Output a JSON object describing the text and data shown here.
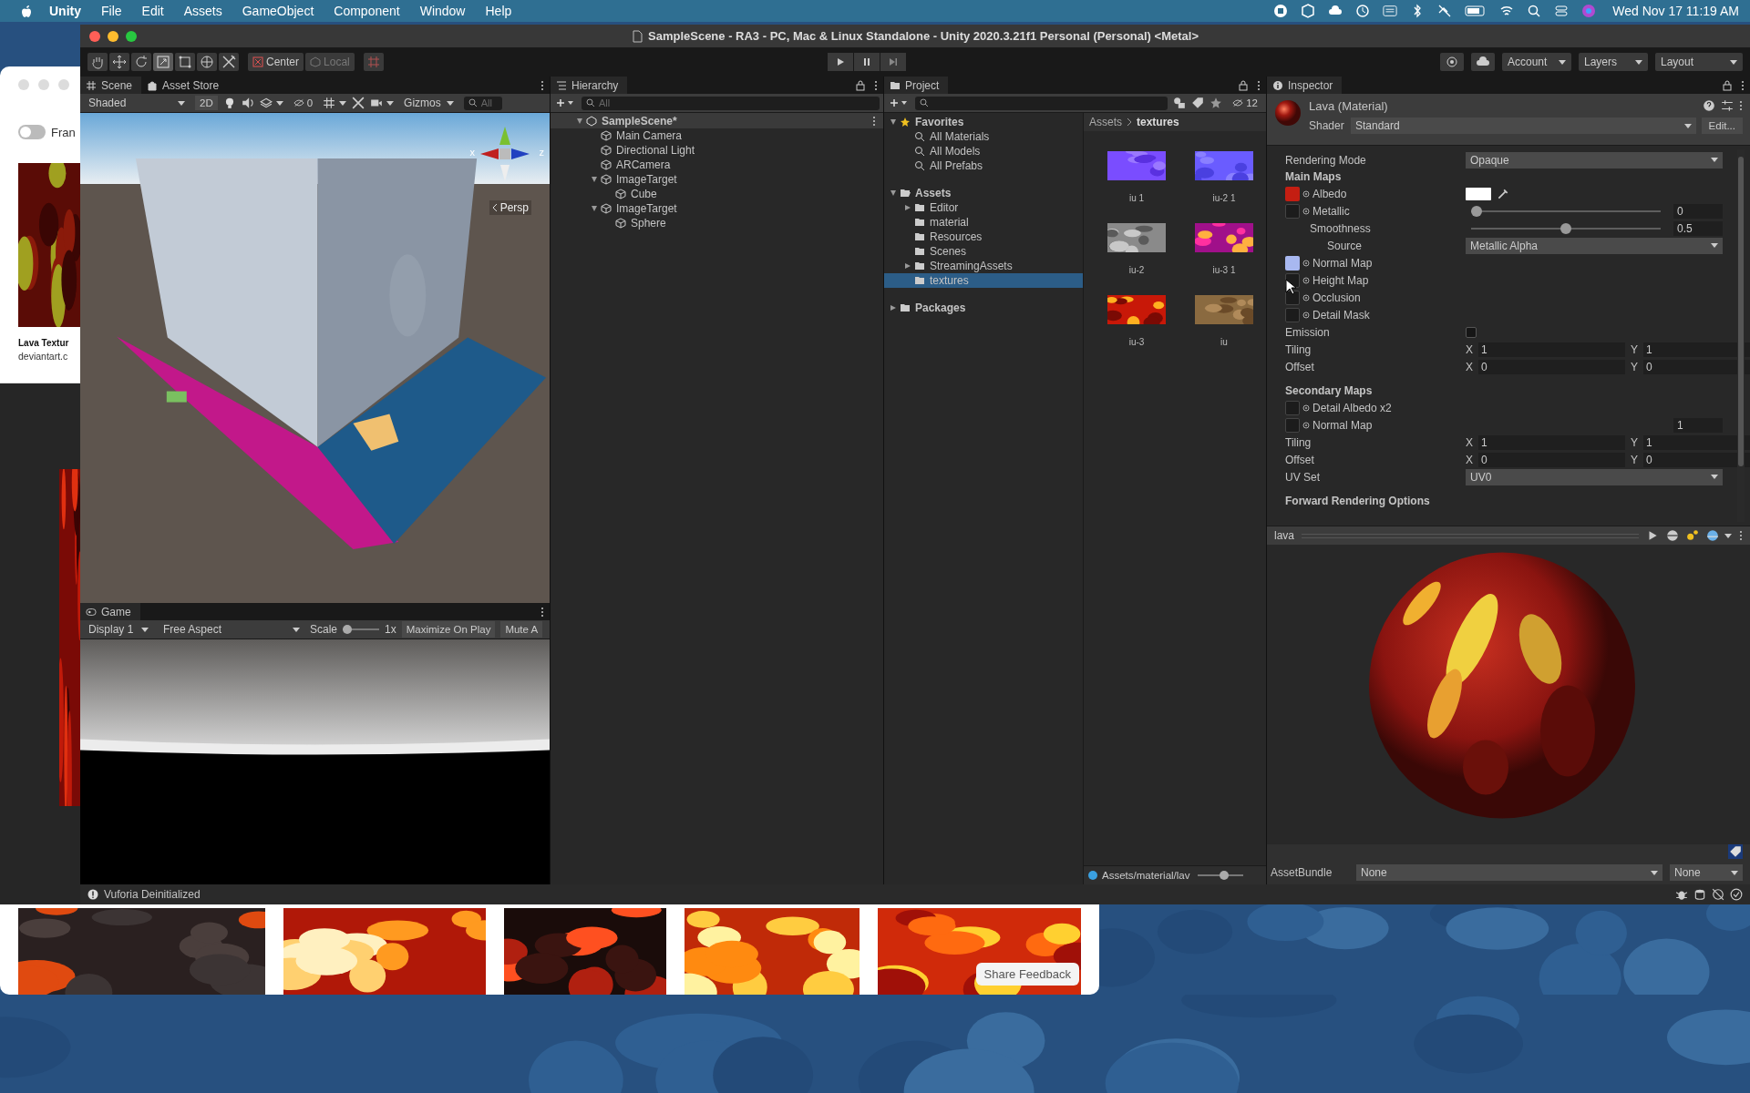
{
  "menu_bar": {
    "app": "Unity",
    "items": [
      "File",
      "Edit",
      "Assets",
      "GameObject",
      "Component",
      "Window",
      "Help"
    ],
    "clock": "Wed Nov 17  11:19 AM"
  },
  "browser": {
    "toggle": {
      "label": "Fran",
      "on": false
    },
    "result_title": "Lava Textur",
    "result_source": "deviantart.c",
    "share_button": "Share Feedback"
  },
  "window": {
    "title": "SampleScene - RA3 - PC, Mac & Linux Standalone - Unity 2020.3.21f1 Personal (Personal) <Metal>"
  },
  "toolbar": {
    "pivot": {
      "label": "Center",
      "disabled": false
    },
    "space": {
      "label": "Local",
      "disabled": true
    },
    "menus": [
      "Account",
      "Layers",
      "Layout"
    ]
  },
  "scene": {
    "tabs": [
      {
        "label": "Scene",
        "selected": true
      },
      {
        "label": "Asset Store",
        "selected": false
      }
    ],
    "shading": "Shaded",
    "mode_2d": "2D",
    "hidden_count": "0",
    "gizmos": "Gizmos",
    "search_placeholder": "All",
    "axes": [
      "x",
      "z"
    ],
    "projection": "Persp"
  },
  "game": {
    "tab": "Game",
    "display": "Display 1",
    "aspect": "Free Aspect",
    "scale_label": "Scale",
    "scale": {
      "level": 0,
      "reading": "1x"
    },
    "buttons": [
      "Maximize On Play",
      "Mute A"
    ]
  },
  "hierarchy": {
    "title": "Hierarchy",
    "search_placeholder": "All",
    "tree": [
      {
        "label": "SampleScene*",
        "kind": "scene",
        "expanded": true,
        "selected": false,
        "children": [
          {
            "label": "Main Camera",
            "kind": "object",
            "selected": false
          },
          {
            "label": "Directional Light",
            "kind": "object",
            "selected": false
          },
          {
            "label": "ARCamera",
            "kind": "object",
            "selected": false
          },
          {
            "label": "ImageTarget",
            "kind": "object",
            "expanded": true,
            "selected": false,
            "children": [
              {
                "label": "Cube",
                "kind": "object",
                "selected": false
              }
            ]
          },
          {
            "label": "ImageTarget",
            "kind": "object",
            "expanded": true,
            "selected": false,
            "children": [
              {
                "label": "Sphere",
                "kind": "object",
                "selected": false
              }
            ]
          }
        ]
      }
    ]
  },
  "project": {
    "title": "Project",
    "hidden_count": "12",
    "tree": [
      {
        "label": "Favorites",
        "kind": "favorites",
        "expanded": true,
        "selected": false,
        "children": [
          {
            "label": "All Materials",
            "kind": "search",
            "selected": false
          },
          {
            "label": "All Models",
            "kind": "search",
            "selected": false
          },
          {
            "label": "All Prefabs",
            "kind": "search",
            "selected": false
          }
        ]
      },
      {
        "label": "Assets",
        "kind": "folder",
        "expanded": true,
        "selected": false,
        "children": [
          {
            "label": "Editor",
            "kind": "folder",
            "expanded": false,
            "selected": false
          },
          {
            "label": "material",
            "kind": "folder",
            "selected": false
          },
          {
            "label": "Resources",
            "kind": "folder",
            "selected": false
          },
          {
            "label": "Scenes",
            "kind": "folder",
            "selected": false
          },
          {
            "label": "StreamingAssets",
            "kind": "folder",
            "expanded": false,
            "selected": false
          },
          {
            "label": "textures",
            "kind": "folder",
            "selected": true
          }
        ]
      },
      {
        "label": "Packages",
        "kind": "folder",
        "expanded": false,
        "selected": false
      }
    ],
    "breadcrumb": [
      "Assets",
      "textures"
    ],
    "assets": [
      {
        "label": "iu 1",
        "selected": false
      },
      {
        "label": "iu-2 1",
        "selected": false
      },
      {
        "label": "iu-2",
        "selected": false
      },
      {
        "label": "iu-3 1",
        "selected": false
      },
      {
        "label": "iu-3",
        "selected": false
      },
      {
        "label": "iu",
        "selected": false
      }
    ],
    "path": "Assets/material/lav",
    "zoom": {
      "level": 0.6
    }
  },
  "inspector": {
    "title": "Inspector",
    "asset": "Lava (Material)",
    "shader_label": "Shader",
    "shader": "Standard",
    "edit_button": "Edit...",
    "properties": [
      {
        "kind": "dropdown",
        "label": "Rendering Mode",
        "value": "Opaque"
      },
      {
        "kind": "header",
        "label": "Main Maps"
      },
      {
        "kind": "texture_color",
        "label": "Albedo",
        "color": "#c41e12"
      },
      {
        "kind": "texture",
        "label": "Metallic",
        "level": 0,
        "value": "0",
        "children": [
          {
            "kind": "slider",
            "label": "Smoothness",
            "level": 0.5,
            "value": "0.5",
            "children": [
              {
                "kind": "dropdown",
                "label": "Source",
                "value": "Metallic Alpha"
              }
            ]
          }
        ]
      },
      {
        "kind": "texture",
        "label": "Normal Map",
        "color": "#a8b8f0"
      },
      {
        "kind": "texture",
        "label": "Height Map"
      },
      {
        "kind": "texture",
        "label": "Occlusion"
      },
      {
        "kind": "texture",
        "label": "Detail Mask"
      },
      {
        "kind": "checkbox",
        "label": "Emission",
        "checked": false
      },
      {
        "kind": "vector",
        "label": "Tiling",
        "components": [
          {
            "axis": "X",
            "value": "1"
          },
          {
            "axis": "Y",
            "value": "1"
          }
        ]
      },
      {
        "kind": "vector",
        "label": "Offset",
        "components": [
          {
            "axis": "X",
            "value": "0"
          },
          {
            "axis": "Y",
            "value": "0"
          }
        ]
      },
      {
        "kind": "header",
        "label": "Secondary Maps"
      },
      {
        "kind": "texture",
        "label": "Detail Albedo x2"
      },
      {
        "kind": "texture",
        "label": "Normal Map",
        "value": "1"
      },
      {
        "kind": "vector",
        "label": "Tiling",
        "components": [
          {
            "axis": "X",
            "value": "1"
          },
          {
            "axis": "Y",
            "value": "1"
          }
        ]
      },
      {
        "kind": "vector",
        "label": "Offset",
        "components": [
          {
            "axis": "X",
            "value": "0"
          },
          {
            "axis": "Y",
            "value": "0"
          }
        ]
      },
      {
        "kind": "dropdown",
        "label": "UV Set",
        "value": "UV0"
      },
      {
        "kind": "header",
        "label": "Forward Rendering Options"
      }
    ],
    "preview_title": "lava",
    "asset_bundle": {
      "label": "AssetBundle",
      "name": "None",
      "variant": "None"
    }
  },
  "status_bar": {
    "message": "Vuforia Deinitialized"
  }
}
